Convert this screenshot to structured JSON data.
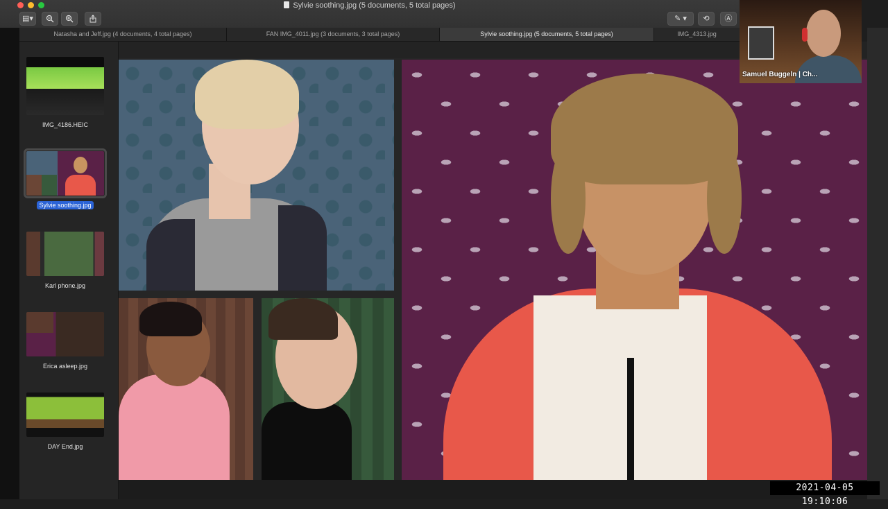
{
  "window": {
    "title": "Sylvie soothing.jpg (5 documents, 5 total pages)"
  },
  "toolbar": {
    "sidebar_toggle_icon": "sidebar-icon",
    "zoom_out_icon": "zoom-out-icon",
    "zoom_in_icon": "zoom-in-icon",
    "share_icon": "share-icon",
    "markup_icon": "pen-icon",
    "rotate_icon": "rotate-icon",
    "annotate_icon": "markup-circle-icon"
  },
  "tabs": [
    {
      "label": "Natasha and Jeff.jpg (4 documents, 4 total pages)",
      "active": false
    },
    {
      "label": "FAN IMG_4011.jpg (3 documents, 3 total pages)",
      "active": false
    },
    {
      "label": "Sylvie soothing.jpg (5 documents, 5 total pages)",
      "active": true
    },
    {
      "label": "IMG_4313.jpg",
      "active": false
    }
  ],
  "sidebar": {
    "items": [
      {
        "label": "IMG_4186.HEIC",
        "selected": false
      },
      {
        "label": "Sylvie soothing.jpg",
        "selected": true
      },
      {
        "label": "Karl phone.jpg",
        "selected": false
      },
      {
        "label": "Erica asleep.jpg",
        "selected": false
      },
      {
        "label": "DAY End.jpg",
        "selected": false
      }
    ]
  },
  "video": {
    "participant": "Samuel Buggeln | Ch..."
  },
  "timestamp": "2021-04-05  19:10:06",
  "colors": {
    "accent": "#2b63d6",
    "purple_bg": "#5a2147",
    "blue_bg": "#4a6378"
  }
}
